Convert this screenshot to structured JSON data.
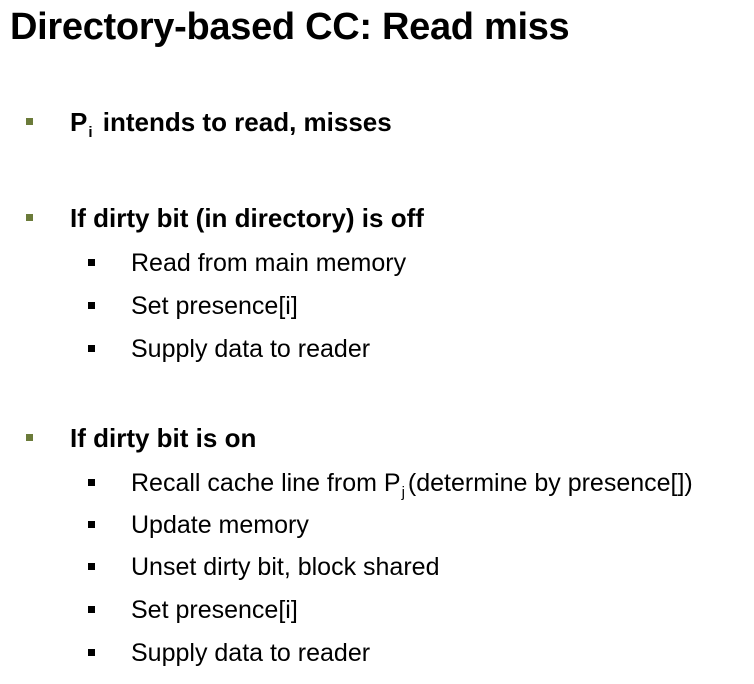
{
  "title": "Directory-based CC: Read miss",
  "b1": {
    "prefix": "P",
    "sub": "i",
    "rest": " intends to read, misses"
  },
  "b2": {
    "label": "If dirty bit (in directory) is off",
    "items": [
      "Read from main memory",
      "Set presence[i]",
      "Supply data to reader"
    ]
  },
  "b3": {
    "label": "If dirty bit is on",
    "recall": {
      "prefix": "Recall cache line from P",
      "sub": "j",
      "rest": "(determine by presence[])"
    },
    "items": [
      "Update memory",
      "Unset dirty bit, block shared",
      "Set presence[i]",
      "Supply data to reader"
    ]
  },
  "colors": {
    "level1_marker": "#6b7b3a",
    "level2_marker": "#000000"
  }
}
